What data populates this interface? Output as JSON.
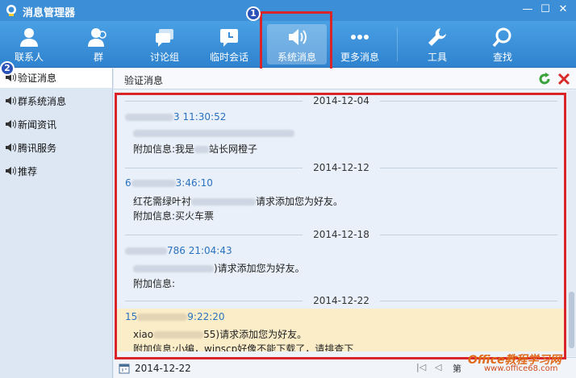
{
  "window": {
    "title": "消息管理器",
    "minimize": "—",
    "maximize": "☐",
    "close": "✕"
  },
  "toolbar": {
    "items": [
      {
        "label": "联系人",
        "icon": "person-icon"
      },
      {
        "label": "群",
        "icon": "group-icon"
      },
      {
        "label": "讨论组",
        "icon": "discussion-icon"
      },
      {
        "label": "临时会话",
        "icon": "temp-chat-icon"
      },
      {
        "label": "系统消息",
        "icon": "speaker-icon",
        "active": true
      },
      {
        "label": "更多消息",
        "icon": "more-icon"
      },
      {
        "label": "工具",
        "icon": "wrench-icon"
      },
      {
        "label": "查找",
        "icon": "search-icon"
      }
    ]
  },
  "annotations": {
    "badge1": "1",
    "badge2": "2"
  },
  "sidebar": {
    "items": [
      {
        "label": "验证消息",
        "active": true
      },
      {
        "label": "群系统消息"
      },
      {
        "label": "新闻资讯"
      },
      {
        "label": "腾讯服务"
      },
      {
        "label": "推荐"
      }
    ]
  },
  "main": {
    "title": "验证消息",
    "messages": [
      {
        "date": "2014-12-04",
        "time": "3 11:30:52",
        "line1": "",
        "line2_prefix": "附加信息:我是",
        "line2_suffix": "站长网橙子"
      },
      {
        "date": "2014-12-12",
        "time_prefix": "6",
        "time": "3:46:10",
        "line1_prefix": "红花需绿叶衬",
        "line1_suffix": "请求添加您为好友。",
        "line2": "附加信息:买火车票"
      },
      {
        "date": "2014-12-18",
        "time": "786 21:04:43",
        "line1_suffix": ")请求添加您为好友。",
        "line2": "附加信息:"
      },
      {
        "date": "2014-12-22",
        "time_prefix": "15",
        "time": "9:22:20",
        "line1_prefix": "xiao",
        "line1_suffix": "55)请求添加您为好友。",
        "line2": "附加信息:小编，winscp好像不能下载了，请排查下"
      }
    ],
    "current_date": "2014-12-22",
    "nav": {
      "first": "|◁",
      "prev": "◁",
      "page_label": "第"
    }
  },
  "watermark": {
    "brand": "Office教程学习网",
    "url": "www.office68.com"
  },
  "colors": {
    "accent": "#3c8ed6",
    "highlight": "#fbedc8",
    "annotation": "#d9252a"
  }
}
